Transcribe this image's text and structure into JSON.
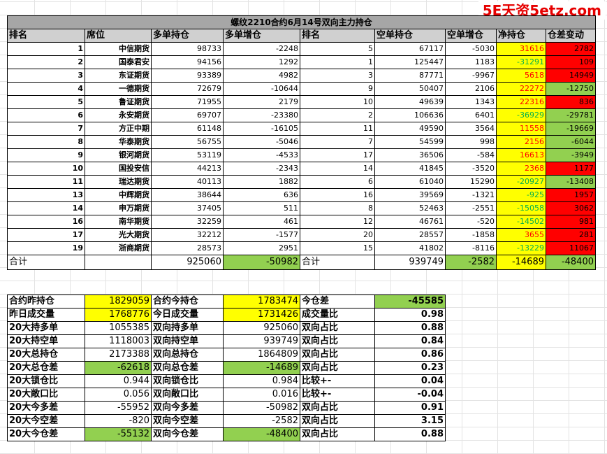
{
  "watermark": "5E天资5etz.com",
  "title": "螺纹2210合约6月14号双向主力持仓",
  "headers": [
    "排名",
    "席位",
    "多单持仓",
    "多单增仓",
    "排名",
    "空单持仓",
    "空单增仓",
    "净持仓",
    "仓差变动"
  ],
  "rows": [
    {
      "rank": "1",
      "broker": "中信期货",
      "long": "98733",
      "long_chg": "-2248",
      "srank": "5",
      "short": "67117",
      "short_chg": "-5030",
      "net": "31616",
      "diff": "2782"
    },
    {
      "rank": "2",
      "broker": "国泰君安",
      "long": "94156",
      "long_chg": "1292",
      "srank": "1",
      "short": "125447",
      "short_chg": "1183",
      "net": "-31291",
      "diff": "109"
    },
    {
      "rank": "3",
      "broker": "东证期货",
      "long": "93389",
      "long_chg": "4982",
      "srank": "3",
      "short": "87771",
      "short_chg": "-9967",
      "net": "5618",
      "diff": "14949"
    },
    {
      "rank": "4",
      "broker": "一德期货",
      "long": "72679",
      "long_chg": "-10644",
      "srank": "9",
      "short": "50407",
      "short_chg": "2106",
      "net": "22272",
      "diff": "-12750"
    },
    {
      "rank": "5",
      "broker": "鲁证期货",
      "long": "71955",
      "long_chg": "2179",
      "srank": "10",
      "short": "49639",
      "short_chg": "1343",
      "net": "22316",
      "diff": "836"
    },
    {
      "rank": "6",
      "broker": "永安期货",
      "long": "69707",
      "long_chg": "-23380",
      "srank": "2",
      "short": "106636",
      "short_chg": "6401",
      "net": "-36929",
      "diff": "-29781"
    },
    {
      "rank": "7",
      "broker": "方正中期",
      "long": "61148",
      "long_chg": "-16105",
      "srank": "11",
      "short": "49590",
      "short_chg": "3564",
      "net": "11558",
      "diff": "-19669"
    },
    {
      "rank": "8",
      "broker": "华泰期货",
      "long": "56755",
      "long_chg": "-5046",
      "srank": "7",
      "short": "54599",
      "short_chg": "998",
      "net": "2156",
      "diff": "-6044"
    },
    {
      "rank": "9",
      "broker": "银河期货",
      "long": "53119",
      "long_chg": "-4533",
      "srank": "17",
      "short": "36506",
      "short_chg": "-584",
      "net": "16613",
      "diff": "-3949"
    },
    {
      "rank": "10",
      "broker": "国投安信",
      "long": "44213",
      "long_chg": "-2343",
      "srank": "14",
      "short": "41845",
      "short_chg": "-3520",
      "net": "2368",
      "diff": "1177"
    },
    {
      "rank": "11",
      "broker": "瑞达期货",
      "long": "40113",
      "long_chg": "1882",
      "srank": "6",
      "short": "61040",
      "short_chg": "15290",
      "net": "-20927",
      "diff": "-13408"
    },
    {
      "rank": "13",
      "broker": "中辉期货",
      "long": "38644",
      "long_chg": "636",
      "srank": "16",
      "short": "39569",
      "short_chg": "-1321",
      "net": "-925",
      "diff": "1957"
    },
    {
      "rank": "14",
      "broker": "申万期货",
      "long": "37405",
      "long_chg": "511",
      "srank": "8",
      "short": "52463",
      "short_chg": "-2551",
      "net": "-15058",
      "diff": "3062"
    },
    {
      "rank": "16",
      "broker": "南华期货",
      "long": "32259",
      "long_chg": "461",
      "srank": "12",
      "short": "46761",
      "short_chg": "-520",
      "net": "-14502",
      "diff": "981"
    },
    {
      "rank": "17",
      "broker": "光大期货",
      "long": "32212",
      "long_chg": "-1577",
      "srank": "20",
      "short": "28557",
      "short_chg": "-1858",
      "net": "3655",
      "diff": "281"
    },
    {
      "rank": "19",
      "broker": "浙商期货",
      "long": "28573",
      "long_chg": "2951",
      "srank": "15",
      "short": "41802",
      "short_chg": "-8116",
      "net": "-13229",
      "diff": "11067"
    }
  ],
  "total": {
    "label": "合计",
    "long": "925060",
    "long_chg": "-50982",
    "label2": "合计",
    "short": "939749",
    "short_chg": "-2582",
    "net": "-14689",
    "diff": "-48400"
  },
  "summary": [
    {
      "l1": "合约昨持仓",
      "v1": "1829059",
      "l2": "合约今持仓",
      "v2": "1783474",
      "l3": "今仓差",
      "v3": "-45585"
    },
    {
      "l1": "昨日成交量",
      "v1": "1768776",
      "l2": "今日成交量",
      "v2": "1731426",
      "l3": "成交量比",
      "v3": "0.98"
    },
    {
      "l1": "20大持多单",
      "v1": "1055385",
      "l2": "双向持多单",
      "v2": "925060",
      "l3": "双向占比",
      "v3": "0.88"
    },
    {
      "l1": "20大持空单",
      "v1": "1118003",
      "l2": "双向持空单",
      "v2": "939749",
      "l3": "双向占比",
      "v3": "0.84"
    },
    {
      "l1": "20大总持仓",
      "v1": "2173388",
      "l2": "双向总持仓",
      "v2": "1864809",
      "l3": "双向占比",
      "v3": "0.86"
    },
    {
      "l1": "20大总仓差",
      "v1": "-62618",
      "l2": "双向总仓差",
      "v2": "-14689",
      "l3": "双向占比",
      "v3": "0.23"
    },
    {
      "l1": "20大锁仓比",
      "v1": "0.944",
      "l2": "双向锁仓比",
      "v2": "0.984",
      "l3": "比较+-",
      "v3": "0.04"
    },
    {
      "l1": "20大敞口比",
      "v1": "0.056",
      "l2": "双向敞口比",
      "v2": "0.016",
      "l3": "比较+-",
      "v3": "-0.04"
    },
    {
      "l1": "20大今多差",
      "v1": "-55952",
      "l2": "双向今多差",
      "v2": "-50982",
      "l3": "双向占比",
      "v3": "0.91"
    },
    {
      "l1": "20大今空差",
      "v1": "-820",
      "l2": "双向今空差",
      "v2": "-2582",
      "l3": "双向占比",
      "v3": "3.15"
    },
    {
      "l1": "20大今仓差",
      "v1": "-55132",
      "l2": "双向今仓差",
      "v2": "-48400",
      "l3": "双向占比",
      "v3": "0.88"
    }
  ],
  "colors": {
    "yellow": "#ffff00",
    "red": "#ff0000",
    "green": "#92d050",
    "header_gray": "#d0d0d0",
    "title_gray": "#a6a6a6",
    "text_red": "#ff0000",
    "text_green": "#00b050"
  }
}
